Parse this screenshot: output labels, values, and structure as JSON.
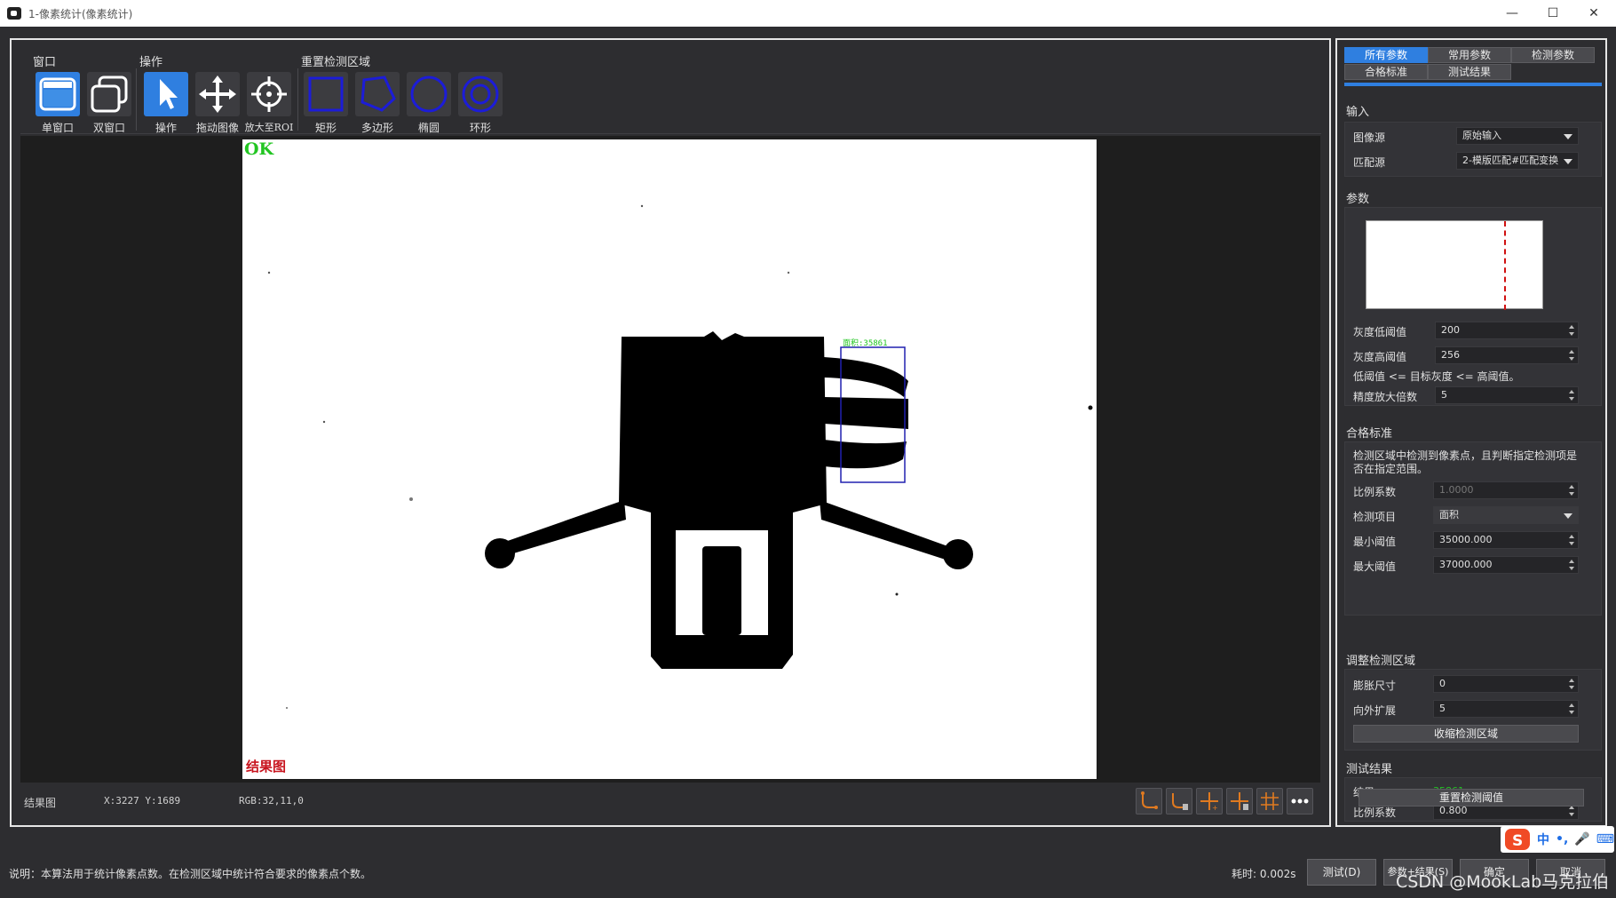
{
  "window": {
    "title": "1-像素统计(像素统计)",
    "minimize": "—",
    "maximize": "☐",
    "close": "✕"
  },
  "ribbon": {
    "group_window": "窗口",
    "group_operation": "操作",
    "group_region": "重置检测区域",
    "tools": {
      "single": "单窗口",
      "double": "双窗口",
      "operate": "操作",
      "drag": "拖动图像",
      "zoom_roi": "放大至ROI",
      "rect": "矩形",
      "polygon": "多边形",
      "ellipse": "椭圆",
      "ring": "环形"
    }
  },
  "viewer": {
    "ok_text": "OK",
    "result_text": "结果图",
    "roi_label": "面积:35861"
  },
  "status": {
    "image_name": "结果图",
    "coords": "X:3227 Y:1689",
    "rgb": "RGB:32,11,0"
  },
  "right": {
    "tabs": [
      "所有参数",
      "常用参数",
      "检测参数",
      "合格标准",
      "测试结果"
    ],
    "input": {
      "title": "输入",
      "image_source_label": "图像源",
      "image_source_value": "原始输入",
      "match_source_label": "匹配源",
      "match_source_value": "2-模版匹配#匹配变换"
    },
    "params": {
      "title": "参数",
      "gray_low_label": "灰度低阈值",
      "gray_low_value": "200",
      "gray_high_label": "灰度高阈值",
      "gray_high_value": "256",
      "note": "低阈值 <= 目标灰度 <= 高阈值。",
      "precision_label": "精度放大倍数",
      "precision_value": "5"
    },
    "criteria": {
      "title": "合格标准",
      "desc": "检测区域中检测到像素点，且判断指定检测项是否在指定范围。",
      "ratio_label": "比例系数",
      "ratio_value": "1.0000",
      "item_label": "检测项目",
      "item_value": "面积",
      "min_label": "最小阈值",
      "min_value": "35000.000",
      "max_label": "最大阈值",
      "max_value": "37000.000"
    },
    "adjust": {
      "title": "调整检测区域",
      "dilate_label": "膨胀尺寸",
      "dilate_value": "0",
      "expand_label": "向外扩展",
      "expand_value": "5",
      "shrink_button": "收缩检测区域"
    },
    "test": {
      "title": "测试结果",
      "result_label": "结果",
      "result_value": "35861",
      "ratio_label": "比例系数",
      "ratio_value": "0.800",
      "reset_button": "重置检测阈值"
    }
  },
  "footer": {
    "note": "说明：本算法用于统计像素点数。在检测区域中统计符合要求的像素点个数。",
    "elapsed_label": "耗时:",
    "elapsed_value": "0.002s",
    "test_button": "测试(D)",
    "param_button": "参数+结果(S)",
    "ok_button": "确定",
    "cancel_button": "取消",
    "watermark": "CSDN @MookLab马克拉伯"
  },
  "ime": {
    "lang": "中",
    "punct": "•,",
    "mic": "🎤",
    "kbd": "⌨"
  },
  "colors": {
    "accent": "#2f7fe0",
    "ok_green": "#22c522",
    "result_red": "#c8141e",
    "roi_blue": "#2020b0"
  }
}
